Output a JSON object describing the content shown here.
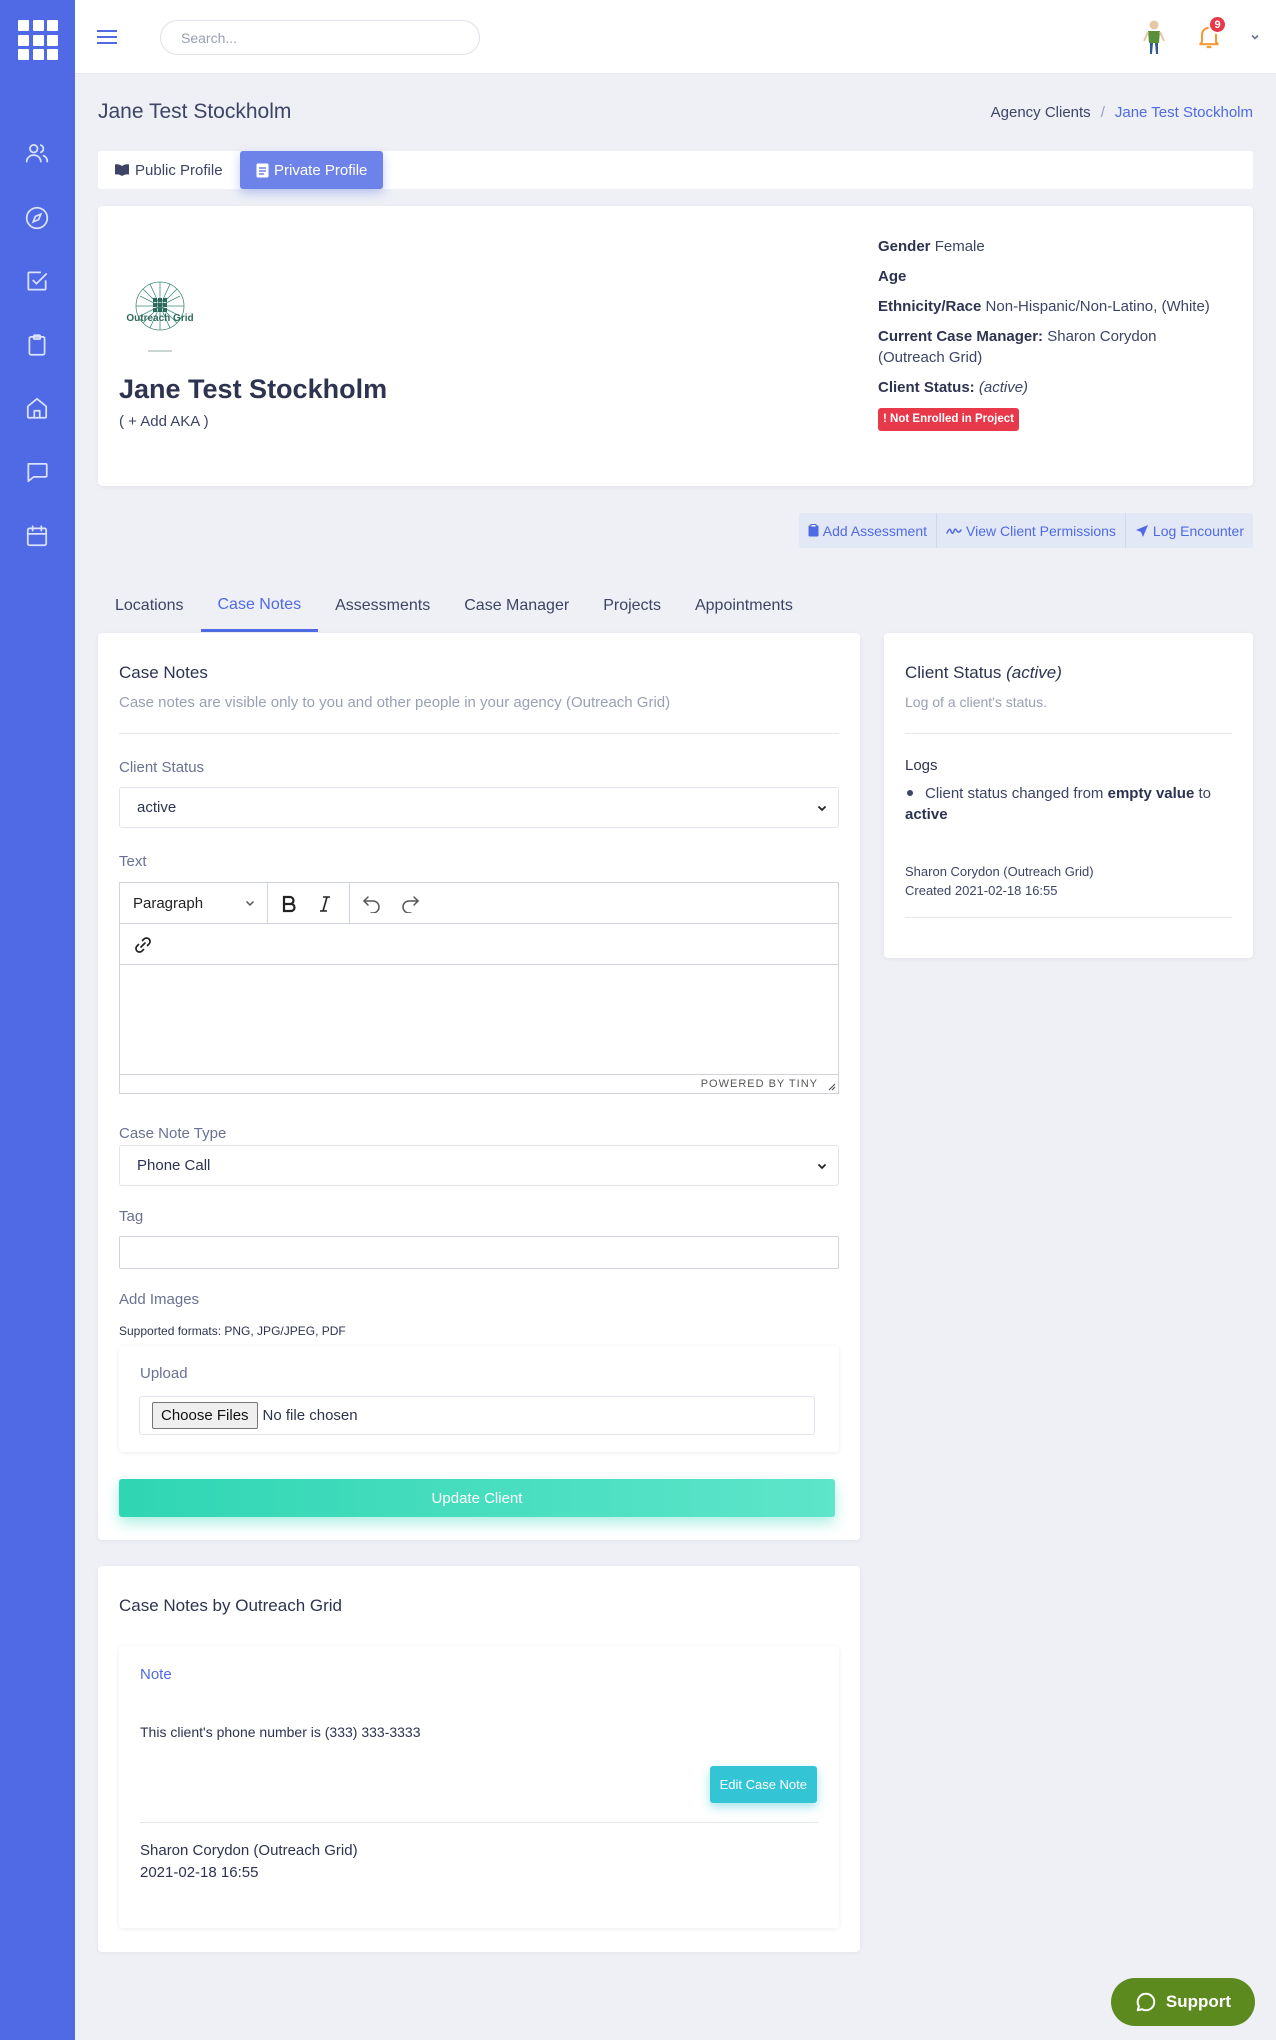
{
  "topbar": {
    "search_placeholder": "Search...",
    "notification_count": "9"
  },
  "page": {
    "title": "Jane Test Stockholm",
    "breadcrumb": [
      "Agency Clients",
      "/",
      "Jane Test Stockholm"
    ]
  },
  "profile_tabs": {
    "public": "Public Profile",
    "private": "Private Profile"
  },
  "profile": {
    "logo_text": "Outreach Grid",
    "name": "Jane Test Stockholm",
    "add_aka": "( + Add AKA )",
    "gender_label": "Gender",
    "gender": "Female",
    "age_label": "Age",
    "age": "",
    "ethnicity_label": "Ethnicity/Race",
    "ethnicity": "Non-Hispanic/Non-Latino, (White)",
    "case_manager_label": "Current Case Manager:",
    "case_manager": "Sharon Corydon (Outreach Grid)",
    "status_label": "Client Status:",
    "status": "(active)",
    "enrollment_badge": "Not Enrolled in Project"
  },
  "actions": {
    "add_assessment": "Add Assessment",
    "view_permissions": "View Client Permissions",
    "log_encounter": "Log Encounter"
  },
  "tabs": [
    "Locations",
    "Case Notes",
    "Assessments",
    "Case Manager",
    "Projects",
    "Appointments"
  ],
  "case_notes_form": {
    "title": "Case Notes",
    "subtitle": "Case notes are visible only to you and other people in your agency (Outreach Grid)",
    "client_status_label": "Client Status",
    "client_status_value": "active",
    "text_label": "Text",
    "editor_block_format": "Paragraph",
    "editor_status": "POWERED BY TINY",
    "note_type_label": "Case Note Type",
    "note_type_value": "Phone Call",
    "tag_label": "Tag",
    "tag_value": "",
    "add_images_label": "Add Images",
    "supported_formats": "Supported formats: PNG, JPG/JPEG, PDF",
    "upload_label": "Upload",
    "choose_files": "Choose Files",
    "no_file": "No file chosen",
    "submit": "Update Client"
  },
  "client_status": {
    "title": "Client Status",
    "title_status": "(active)",
    "subtitle": "Log of a client's status.",
    "logs_label": "Logs",
    "log_prefix": "Client status changed from",
    "log_from": "empty value",
    "log_to_word": "to",
    "log_to": "active",
    "log_author": "Sharon Corydon (Outreach Grid)",
    "log_created": "Created 2021-02-18 16:55"
  },
  "notes_list": {
    "title": "Case Notes by Outreach Grid",
    "note_label": "Note",
    "note_text": "This client's phone number is (333) 333-3333",
    "edit_button": "Edit Case Note",
    "author": "Sharon Corydon (Outreach Grid)",
    "date": "2021-02-18 16:55"
  },
  "support": {
    "label": "Support"
  },
  "colors": {
    "primary": "#4f6ae4",
    "success_gradient": "#2fd6b3",
    "danger": "#e8394a",
    "info": "#33c4d6",
    "support": "#5c8a1f"
  }
}
